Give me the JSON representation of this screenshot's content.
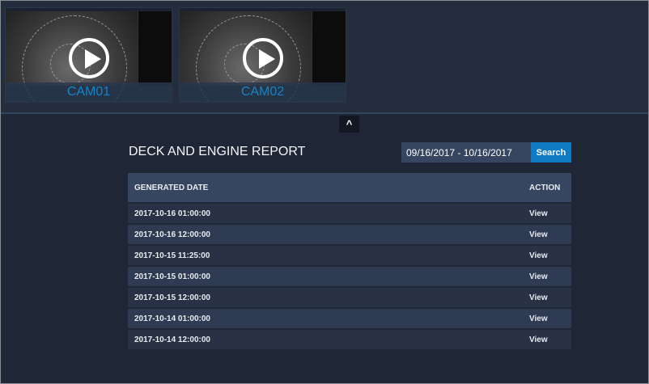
{
  "cameras": [
    {
      "label": "CAM01"
    },
    {
      "label": "CAM02"
    }
  ],
  "collapse_icon": "chevron-up-icon",
  "report": {
    "title": "DECK AND ENGINE REPORT",
    "date_range": "09/16/2017 - 10/16/2017",
    "search_label": "Search",
    "columns": [
      "GENERATED DATE",
      "ACTION"
    ],
    "rows": [
      {
        "date": "2017-10-16 01:00:00",
        "action": "View"
      },
      {
        "date": "2017-10-16 12:00:00",
        "action": "View"
      },
      {
        "date": "2017-10-15 11:25:00",
        "action": "View"
      },
      {
        "date": "2017-10-15 01:00:00",
        "action": "View"
      },
      {
        "date": "2017-10-15 12:00:00",
        "action": "View"
      },
      {
        "date": "2017-10-14 01:00:00",
        "action": "View"
      },
      {
        "date": "2017-10-14 12:00:00",
        "action": "View"
      }
    ]
  }
}
